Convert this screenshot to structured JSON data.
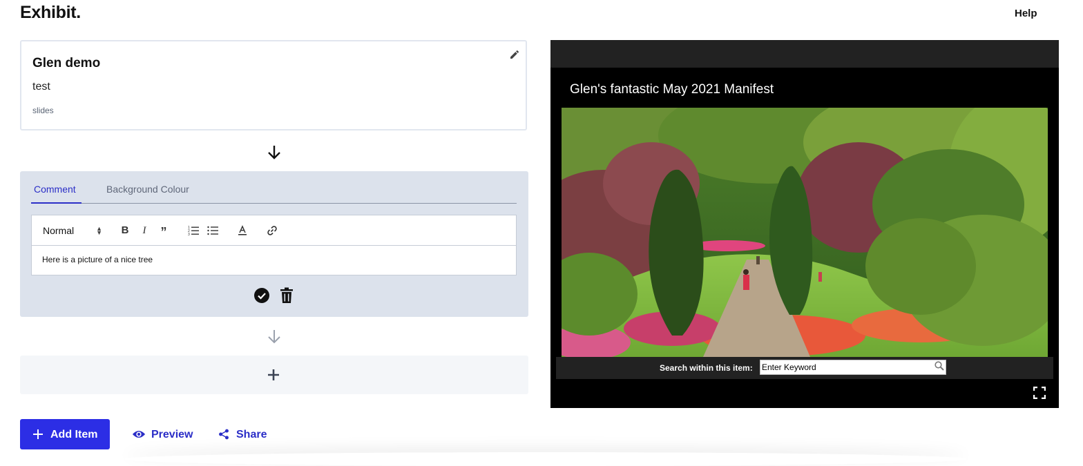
{
  "header": {
    "logo": "Exhibit.",
    "help": "Help"
  },
  "slide_card": {
    "title": "Glen demo",
    "subtitle": "test",
    "type": "slides"
  },
  "comment_panel": {
    "tabs": [
      {
        "label": "Comment",
        "active": true
      },
      {
        "label": "Background Colour",
        "active": false
      }
    ],
    "editor": {
      "format_select": "Normal",
      "toolbar_icons": [
        "bold-icon",
        "italic-icon",
        "quote-icon",
        "ordered-list-icon",
        "bullet-list-icon",
        "text-color-icon",
        "link-icon"
      ],
      "content": "Here is a picture of a nice tree"
    }
  },
  "actions": {
    "add_item": "Add Item",
    "preview": "Preview",
    "share": "Share"
  },
  "viewer": {
    "title": "Glen's fantastic May 2021 Manifest",
    "search_label": "Search within this item:",
    "search_placeholder": "Enter Keyword"
  },
  "colors": {
    "accent": "#2c2ee5",
    "panel": "#dce2ec",
    "viewer_bg": "#000000"
  }
}
